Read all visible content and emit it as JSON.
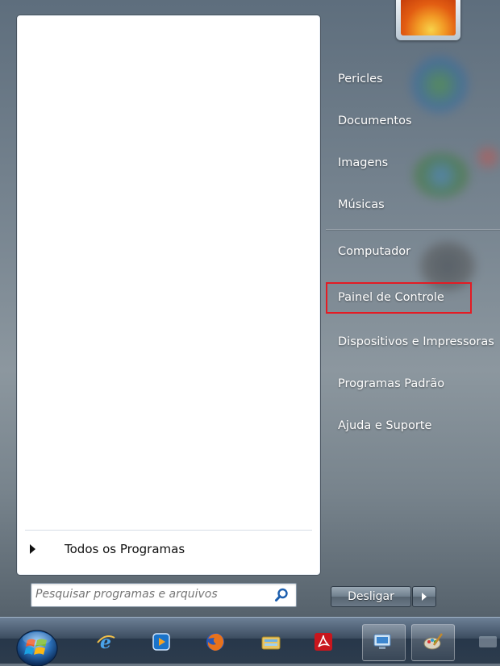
{
  "left_panel": {
    "all_programs_label": "Todos os Programas",
    "search": {
      "placeholder": "Pesquisar programas e arquivos",
      "value": ""
    }
  },
  "right_panel": {
    "items": [
      {
        "label": "Pericles"
      },
      {
        "label": "Documentos"
      },
      {
        "label": "Imagens"
      },
      {
        "label": "Músicas"
      },
      {
        "label": "Computador"
      },
      {
        "label": "Painel de Controle",
        "highlighted": true
      },
      {
        "label": "Dispositivos e Impressoras"
      },
      {
        "label": "Programas Padrão"
      },
      {
        "label": "Ajuda e Suporte"
      }
    ],
    "highlight_color": "#e41b23"
  },
  "shutdown": {
    "label": "Desligar"
  },
  "taskbar": {
    "start_orb": "windows-start-orb-icon",
    "pinned": [
      "internet-explorer-icon",
      "windows-media-player-icon",
      "firefox-icon",
      "windows-explorer-icon",
      "adobe-reader-icon",
      "network-computer-icon",
      "paint-icon"
    ]
  }
}
